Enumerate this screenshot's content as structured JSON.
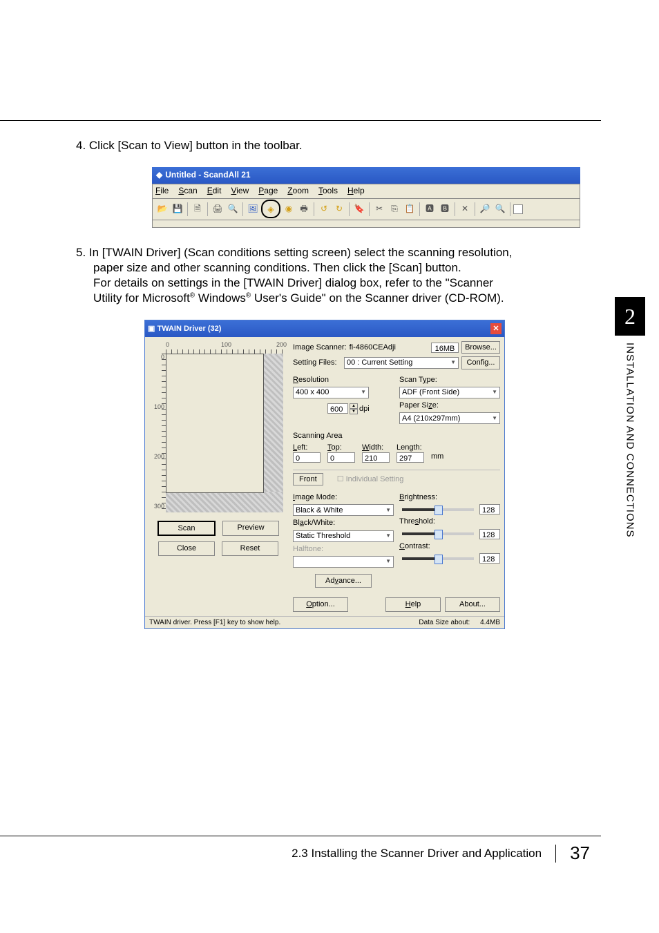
{
  "step4": "4. Click [Scan to View] button in the toolbar.",
  "step5_line1": "5. In [TWAIN Driver] (Scan conditions setting screen) select the scanning resolution,",
  "step5_line2": "paper size and other scanning conditions. Then click the [Scan] button.",
  "step5_line3a": "For details on settings in the [TWAIN Driver] dialog box, refer to the \"Scanner",
  "step5_line3b": "Utility for Microsoft",
  "step5_line3c": " Windows",
  "step5_line3d": " User's Guide\" on the Scanner driver (CD-ROM).",
  "regmark": "®",
  "scandall": {
    "title": "Untitled - ScandAll 21",
    "menus": [
      "File",
      "Scan",
      "Edit",
      "View",
      "Page",
      "Zoom",
      "Tools",
      "Help"
    ],
    "icons": [
      "open-icon",
      "save-icon",
      "new-icon",
      "print-icon",
      "preview-icon",
      "scanner-icon",
      "scan-to-view-icon",
      "scan-icon",
      "scan3-icon",
      "rotate-l-icon",
      "rotate-r-icon",
      "stamp-icon",
      "cut-icon",
      "copy-icon",
      "paste-icon",
      "ocr1-icon",
      "ocr2-icon",
      "delete-icon",
      "zoom-in-icon",
      "zoom-out-icon"
    ]
  },
  "twain": {
    "title": "TWAIN Driver (32)",
    "image_scanner_label": "Image Scanner:",
    "image_scanner_value": "fi-4860CEAdji",
    "mem": "16MB",
    "browse": "Browse...",
    "setting_files_label": "Setting Files:",
    "setting_files_value": "00 : Current Setting",
    "config": "Config...",
    "resolution_label": "Resolution",
    "resolution_value": "400 x 400",
    "custom_res": "600",
    "dpi": "dpi",
    "scan_type_label": "Scan Type:",
    "scan_type_value": "ADF (Front Side)",
    "paper_size_label": "Paper Size:",
    "paper_size_value": "A4 (210x297mm)",
    "scanning_area_label": "Scanning Area",
    "left_label": "Left:",
    "top_label": "Top:",
    "width_label": "Width:",
    "length_label": "Length:",
    "left_value": "0",
    "top_value": "0",
    "width_value": "210",
    "length_value": "297",
    "mm": "mm",
    "front_tab": "Front",
    "individual_setting": "Individual Setting",
    "image_mode_label": "Image Mode:",
    "image_mode_value": "Black & White",
    "brightness_label": "Brightness:",
    "brightness_value": "128",
    "bw_label": "Black/White:",
    "bw_value": "Static Threshold",
    "threshold_label": "Threshold:",
    "threshold_value": "128",
    "halftone_label": "Halftone:",
    "contrast_label": "Contrast:",
    "contrast_value": "128",
    "advance": "Advance...",
    "scan_btn": "Scan",
    "preview_btn": "Preview",
    "close_btn": "Close",
    "reset_btn": "Reset",
    "option_btn": "Option...",
    "help_btn": "Help",
    "about_btn": "About...",
    "status": "TWAIN driver. Press [F1] key to show help.",
    "datasize_label": "Data Size about:",
    "datasize_value": "4.4MB",
    "ruler_h": [
      "0",
      "100",
      "200"
    ],
    "ruler_v": [
      "0",
      "100",
      "200",
      "300"
    ]
  },
  "side": {
    "num": "2",
    "title": "INSTALLATION AND CONNECTIONS"
  },
  "footer": {
    "section": "2.3 Installing the Scanner Driver and Application",
    "page": "37"
  }
}
